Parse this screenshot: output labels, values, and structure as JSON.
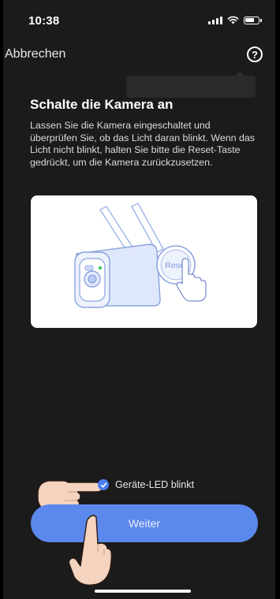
{
  "status_bar": {
    "time": "10:38",
    "signal_icon": "cellular-signal-icon",
    "wifi_icon": "wifi-icon",
    "battery_icon": "battery-icon"
  },
  "nav": {
    "cancel_label": "Abbrechen",
    "help_icon": "help-circle-icon",
    "help_glyph": "?"
  },
  "main": {
    "title": "Schalte die Kamera an",
    "instructions": "Lassen Sie die Kamera eingeschaltet und überprüfen Sie, ob das Licht daran blinkt. Wenn das Licht nicht blinkt, halten Sie bitte die Reset-Taste gedrückt, um die Kamera zurückzusetzen."
  },
  "illustration": {
    "reset_label": "Reset"
  },
  "confirm": {
    "label": "Geräte-LED blinkt",
    "checked": true
  },
  "continue_button": {
    "label": "Weiter"
  },
  "colors": {
    "accent": "#5b88ec",
    "background": "#1b1b1b",
    "card": "#ffffff"
  }
}
